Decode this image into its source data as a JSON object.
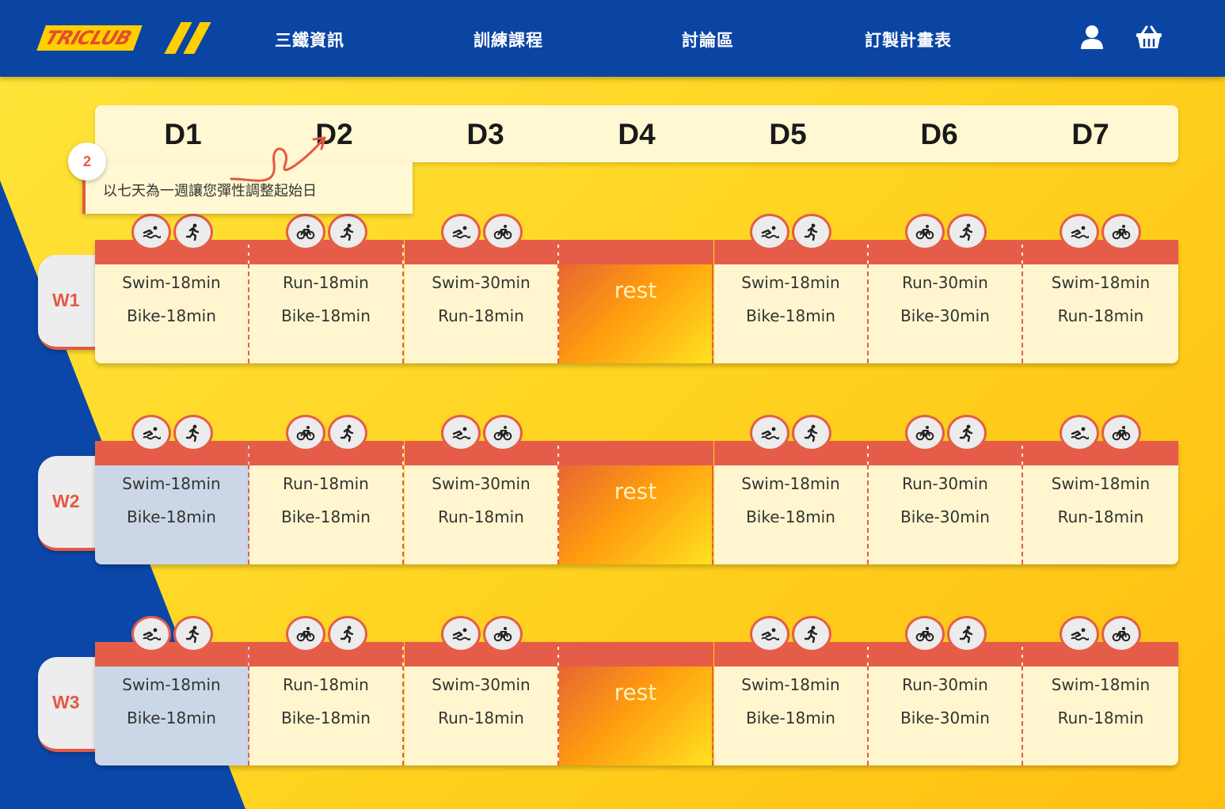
{
  "header": {
    "logo_text": "TRICLUB",
    "nav": [
      "三鐵資訊",
      "訓練課程",
      "討論區",
      "訂製計畫表"
    ],
    "icons": [
      "user-icon",
      "cart-icon"
    ]
  },
  "days": [
    "D1",
    "D2",
    "D3",
    "D4",
    "D5",
    "D6",
    "D7"
  ],
  "tooltip": {
    "step": "2",
    "text": "以七天為一週讓您彈性調整起始日"
  },
  "weeks": [
    {
      "label": "W1",
      "cells": [
        {
          "icons": [
            "swim",
            "run"
          ],
          "lines": [
            "Swim-18min",
            "Bike-18min"
          ]
        },
        {
          "icons": [
            "bike",
            "run"
          ],
          "lines": [
            "Run-18min",
            "Bike-18min"
          ]
        },
        {
          "icons": [
            "swim",
            "bike"
          ],
          "lines": [
            "Swim-30min",
            "Run-18min"
          ]
        },
        {
          "rest": "rest"
        },
        {
          "icons": [
            "swim",
            "run"
          ],
          "lines": [
            "Swim-18min",
            "Bike-18min"
          ]
        },
        {
          "icons": [
            "bike",
            "run"
          ],
          "lines": [
            "Run-30min",
            "Bike-30min"
          ]
        },
        {
          "icons": [
            "swim",
            "bike"
          ],
          "lines": [
            "Swim-18min",
            "Run-18min"
          ]
        }
      ]
    },
    {
      "label": "W2",
      "cells": [
        {
          "icons": [
            "swim",
            "run"
          ],
          "lines": [
            "Swim-18min",
            "Bike-18min"
          ]
        },
        {
          "icons": [
            "bike",
            "run"
          ],
          "lines": [
            "Run-18min",
            "Bike-18min"
          ]
        },
        {
          "icons": [
            "swim",
            "bike"
          ],
          "lines": [
            "Swim-30min",
            "Run-18min"
          ]
        },
        {
          "rest": "rest"
        },
        {
          "icons": [
            "swim",
            "run"
          ],
          "lines": [
            "Swim-18min",
            "Bike-18min"
          ]
        },
        {
          "icons": [
            "bike",
            "run"
          ],
          "lines": [
            "Run-30min",
            "Bike-30min"
          ]
        },
        {
          "icons": [
            "swim",
            "bike"
          ],
          "lines": [
            "Swim-18min",
            "Run-18min"
          ]
        }
      ]
    },
    {
      "label": "W3",
      "cells": [
        {
          "icons": [
            "swim",
            "run"
          ],
          "lines": [
            "Swim-18min",
            "Bike-18min"
          ]
        },
        {
          "icons": [
            "bike",
            "run"
          ],
          "lines": [
            "Run-18min",
            "Bike-18min"
          ]
        },
        {
          "icons": [
            "swim",
            "bike"
          ],
          "lines": [
            "Swim-30min",
            "Run-18min"
          ]
        },
        {
          "rest": "rest"
        },
        {
          "icons": [
            "swim",
            "run"
          ],
          "lines": [
            "Swim-18min",
            "Bike-18min"
          ]
        },
        {
          "icons": [
            "bike",
            "run"
          ],
          "lines": [
            "Run-30min",
            "Bike-30min"
          ]
        },
        {
          "icons": [
            "swim",
            "bike"
          ],
          "lines": [
            "Swim-18min",
            "Run-18min"
          ]
        }
      ]
    }
  ],
  "colors": {
    "brand_blue": "#0a45a3",
    "accent_red": "#e55d49",
    "yellow": "#ffe53a"
  }
}
